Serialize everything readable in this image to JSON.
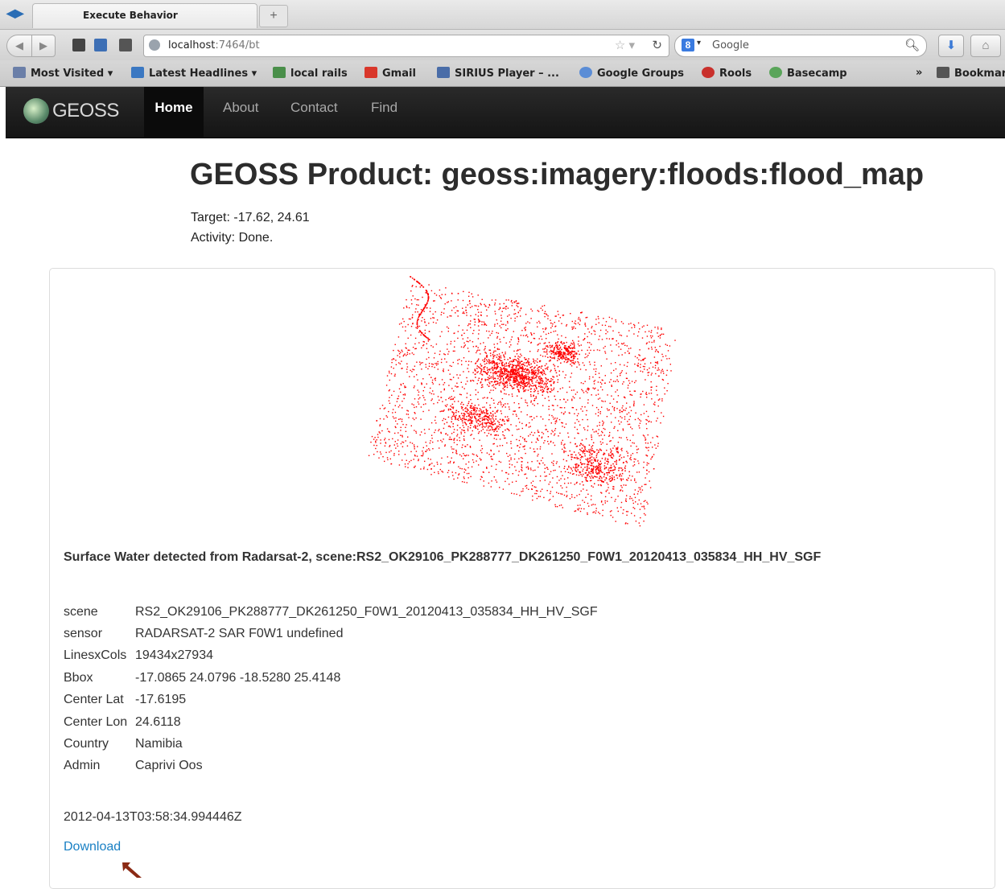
{
  "browser": {
    "tab_title": "Execute Behavior",
    "new_tab_symbol": "+",
    "url_host": "localhost",
    "url_path": ":7464/bt",
    "search_placeholder": "Google",
    "bookmarks": [
      {
        "label": "Most Visited",
        "icon": "gear-icon",
        "color": "#6b7fa8"
      },
      {
        "label": "Latest Headlines",
        "icon": "rss-icon",
        "color": "#3b78c2"
      },
      {
        "label": "local rails",
        "icon": "image-icon",
        "color": "#4a8f4a"
      },
      {
        "label": "Gmail",
        "icon": "gmail-icon",
        "color": "#d9372b"
      },
      {
        "label": "SIRIUS Player – ...",
        "icon": "sirius-icon",
        "color": "#4a6da8"
      },
      {
        "label": "Google Groups",
        "icon": "chat-icon",
        "color": "#5b8dd6"
      },
      {
        "label": "Rools",
        "icon": "rools-icon",
        "color": "#c9302c"
      },
      {
        "label": "Basecamp",
        "icon": "basecamp-icon",
        "color": "#5aa55a"
      }
    ],
    "bookmarks_overflow": "»",
    "bookmarks_menu": "Bookmar"
  },
  "site": {
    "brand": "GEOSS",
    "nav": [
      "Home",
      "About",
      "Contact",
      "Find"
    ]
  },
  "page": {
    "title": "GEOSS Product: geoss:imagery:floods:flood_map",
    "target": "Target: -17.62, 24.61",
    "activity": "Activity: Done.",
    "caption": "Surface Water detected from Radarsat-2, scene:RS2_OK29106_PK288777_DK261250_F0W1_20120413_035834_HH_HV_SGF",
    "properties": [
      {
        "key": "scene",
        "value": "RS2_OK29106_PK288777_DK261250_F0W1_20120413_035834_HH_HV_SGF"
      },
      {
        "key": "sensor",
        "value": "RADARSAT-2 SAR F0W1 undefined"
      },
      {
        "key": "LinesxCols",
        "value": "19434x27934"
      },
      {
        "key": "Bbox",
        "value": "-17.0865 24.0796 -18.5280 25.4148"
      },
      {
        "key": "Center Lat",
        "value": "-17.6195"
      },
      {
        "key": "Center Lon",
        "value": "24.6118"
      },
      {
        "key": "Country",
        "value": "Namibia"
      },
      {
        "key": "Admin",
        "value": "Caprivi Oos"
      }
    ],
    "timestamp": "2012-04-13T03:58:34.994446Z",
    "download_label": "Download",
    "map_dot_color": "#ff0000",
    "arrow_color": "#8b2a14"
  }
}
